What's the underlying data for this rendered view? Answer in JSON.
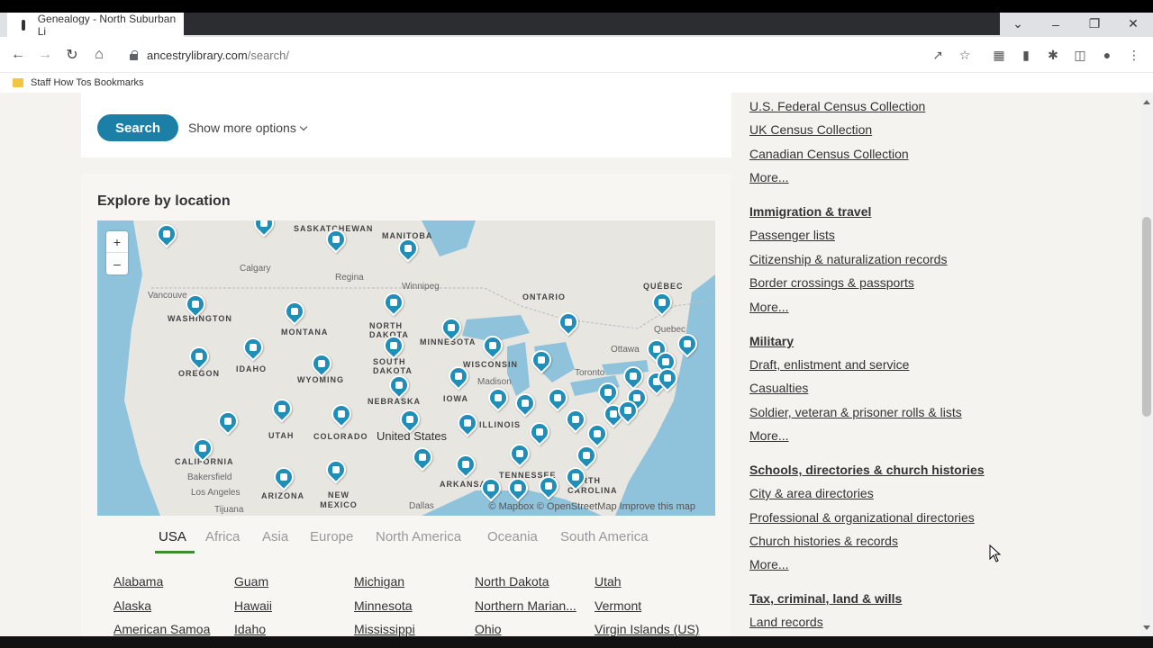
{
  "browser": {
    "tab_title": "Genealogy - North Suburban Li",
    "url_host": "ancestrylibrary.com",
    "url_path": "/search/",
    "bookmark_folder": "Staff How Tos Bookmarks"
  },
  "search": {
    "button_label": "Search",
    "more_options": "Show more options"
  },
  "explore": {
    "heading": "Explore by location",
    "map_labels": {
      "saskatchewan": "SASKATCHEWAN",
      "manitoba": "MANITOBA",
      "ontario": "ONTARIO",
      "quebec": "QUÉBEC",
      "calgary": "Calgary",
      "regina": "Regina",
      "winnipeg": "Winnipeg",
      "vancouver": "Vancouve",
      "washington": "WASHINGTON",
      "montana": "MONTANA",
      "north_dakota": "NORTH DAKOTA",
      "minnesota": "MINNESOTA",
      "oregon": "OREGON",
      "idaho": "IDAHO",
      "wyoming": "WYOMING",
      "south_dakota": "SOUTH DAKOTA",
      "wisconsin": "WISCONSIN",
      "nebraska": "NEBRASKA",
      "iowa": "IOWA",
      "utah": "UTAH",
      "colorado": "COLORADO",
      "illinois": "ILLINOIS",
      "united_states": "United States",
      "california": "CALIFORNIA",
      "arizona": "ARIZONA",
      "new_mexico": "NEW MEXICO",
      "tennessee": "TENNESSEE",
      "arkansas": "ARKANSAS",
      "bakersfield": "Bakersfield",
      "los_angeles": "Los Angeles",
      "tijuana": "Tijuana",
      "dallas": "Dallas",
      "ottawa": "Ottawa",
      "quebec_city": "Quebec",
      "toronto": "Toronto",
      "madison": "Madison",
      "north_carolina": "NORTH CAROLINA",
      "attribution": "© Mapbox © OpenStreetMap Improve this map"
    },
    "tabs": [
      "USA",
      "Africa",
      "Asia",
      "Europe",
      "North America",
      "Oceania",
      "South America"
    ],
    "states": {
      "col1": [
        "Alabama",
        "Alaska",
        "American Samoa"
      ],
      "col2": [
        "Guam",
        "Hawaii",
        "Idaho"
      ],
      "col3": [
        "Michigan",
        "Minnesota",
        "Mississippi"
      ],
      "col4": [
        "North Dakota",
        "Northern Marian...",
        "Ohio"
      ],
      "col5": [
        "Utah",
        "Vermont",
        "Virgin Islands (US)"
      ]
    }
  },
  "sidebar": {
    "census": [
      "U.S. Federal Census Collection",
      "UK Census Collection",
      "Canadian Census Collection",
      "More..."
    ],
    "immigration_heading": "Immigration & travel",
    "immigration": [
      "Passenger lists",
      "Citizenship & naturalization records",
      "Border crossings & passports",
      "More..."
    ],
    "military_heading": "Military",
    "military": [
      "Draft, enlistment and service",
      "Casualties",
      "Soldier, veteran & prisoner rolls & lists",
      "More..."
    ],
    "schools_heading": "Schools, directories & church histories",
    "schools": [
      "City & area directories",
      "Professional & organizational directories",
      "Church histories & records",
      "More..."
    ],
    "tax_heading": "Tax, criminal, land & wills",
    "tax": [
      "Land records"
    ]
  }
}
